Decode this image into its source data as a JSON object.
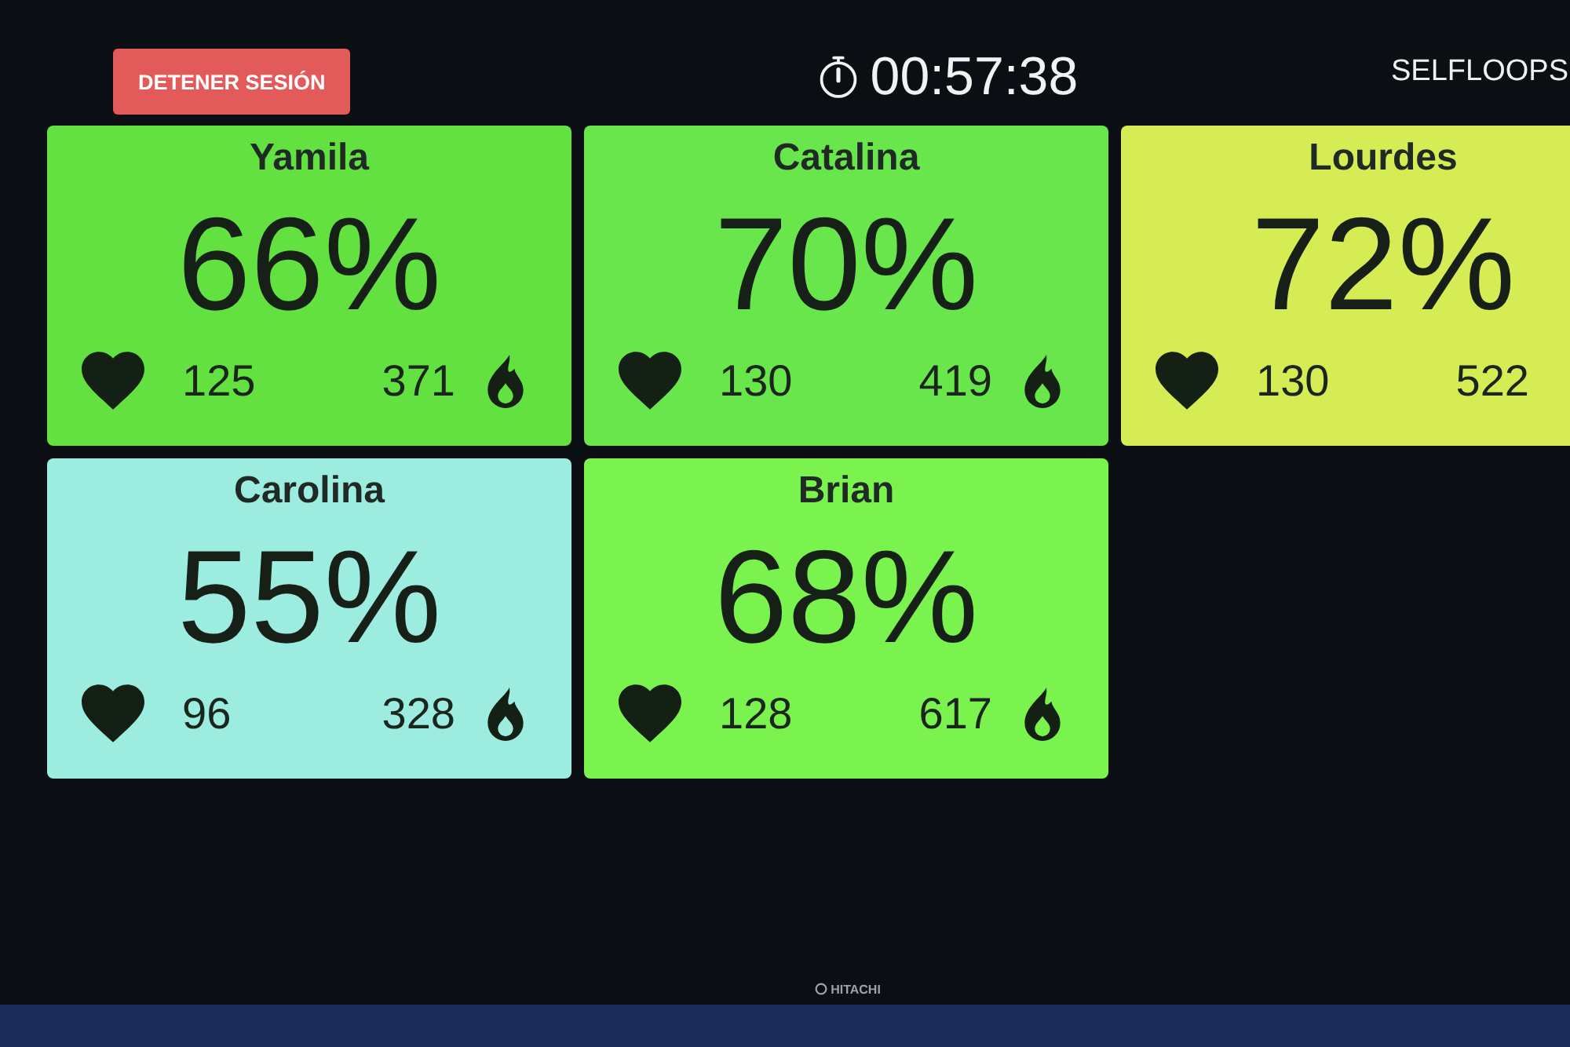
{
  "header": {
    "stop_button": "DETENER SESIÓN",
    "timer": "00:57:38",
    "brand": "SELFLOOPS"
  },
  "riders": [
    {
      "name": "Yamila",
      "percent": "66%",
      "heart_rate": "125",
      "calories": "371",
      "color": "#63e141",
      "clipped": false
    },
    {
      "name": "Catalina",
      "percent": "70%",
      "heart_rate": "130",
      "calories": "419",
      "color": "#69e64c",
      "clipped": false
    },
    {
      "name": "Lourdes",
      "percent": "72%",
      "heart_rate": "130",
      "calories": "522",
      "color": "#d6ec55",
      "clipped": true
    },
    {
      "name": "Carolina",
      "percent": "55%",
      "heart_rate": "96",
      "calories": "328",
      "color": "#9cece0",
      "clipped": false
    },
    {
      "name": "Brian",
      "percent": "68%",
      "heart_rate": "128",
      "calories": "617",
      "color": "#7af34f",
      "clipped": false
    }
  ],
  "bezel": {
    "logo": "HITACHI"
  }
}
